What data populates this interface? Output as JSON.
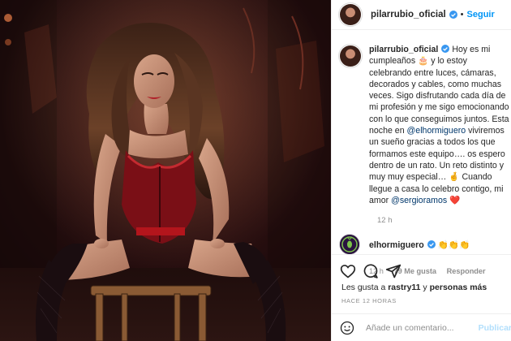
{
  "post": {
    "author": "pilarrubio_oficial",
    "follow_label": "Seguir",
    "separator": "•"
  },
  "caption": {
    "author": "pilarrubio_oficial",
    "part1": "Hoy es mi cumpleaños 🎂 y lo estoy celebrando entre luces, cámaras, decorados y cables, como muchas veces. Sigo disfrutando cada día de mi profesión y me sigo emocionando con lo que conseguimos juntos. Esta noche en ",
    "mention1": "@elhormiguero",
    "part2": " viviremos un sueño gracias a todos los que formamos este equipo…. os espero dentro de un rato. Un reto distinto y muy muy especial… 🤞 Cuando llegue a casa lo celebro contigo, mi amor ",
    "mention2": "@sergioramos",
    "part3": " ❤️",
    "time": "12 h"
  },
  "comment": {
    "author": "elhormiguero",
    "text": "👏👏👏",
    "time": "12 h",
    "likes": "79 Me gusta",
    "reply_label": "Responder"
  },
  "likes": {
    "prefix": "Les gusta a ",
    "user": "rastry11",
    "middle": " y ",
    "others": "personas más"
  },
  "timestamp": "HACE 12 HORAS",
  "add_comment": {
    "placeholder": "Añade un comentario...",
    "publish_label": "Publicar"
  },
  "icons": {
    "verified": "verified-badge-icon",
    "like": "heart-icon",
    "comment": "comment-bubble-icon",
    "share": "paper-plane-icon",
    "emoji": "smiley-emoji-icon",
    "accent": "#0095f6",
    "verified_color": "#3897f0"
  }
}
